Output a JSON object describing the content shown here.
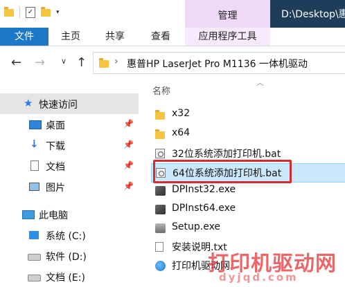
{
  "titlebar": {
    "manage_label": "管理",
    "path_title": "D:\\Desktop\\惠"
  },
  "ribbon": {
    "tabs": [
      "文件",
      "主页",
      "共享",
      "查看",
      "应用程序工具"
    ]
  },
  "address": {
    "crumb": "惠普HP LaserJet Pro M1136 一体机驱动"
  },
  "nav_pane": {
    "quick_access": "快速访问",
    "items": [
      "桌面",
      "下载",
      "文档",
      "图片"
    ],
    "this_pc": "此电脑",
    "drives": [
      "系统 (C:)",
      "软件 (D:)",
      "文档 (E:)"
    ]
  },
  "content": {
    "column_name": "名称",
    "files": [
      {
        "name": "x32",
        "icon": "folder-icon"
      },
      {
        "name": "x64",
        "icon": "folder-icon"
      },
      {
        "name": "32位系统添加打印机.bat",
        "icon": "batch-file-icon"
      },
      {
        "name": "64位系统添加打印机.bat",
        "icon": "batch-file-icon",
        "selected": true
      },
      {
        "name": "DPInst32.exe",
        "icon": "installer-icon"
      },
      {
        "name": "DPInst64.exe",
        "icon": "installer-icon"
      },
      {
        "name": "Setup.exe",
        "icon": "setup-icon"
      },
      {
        "name": "安装说明.txt",
        "icon": "text-file-icon"
      },
      {
        "name": "打印机驱动网",
        "icon": "web-shortcut-icon"
      }
    ]
  },
  "watermark": {
    "text": "打印机驱动网",
    "domain": "dyjqd.com"
  },
  "colors": {
    "file_tab": "#1e78c8",
    "manage_tab": "#f0d8f7",
    "title_bg": "#1e3d5a",
    "selection": "#cce8ff",
    "highlight_box": "#d42c2c"
  }
}
